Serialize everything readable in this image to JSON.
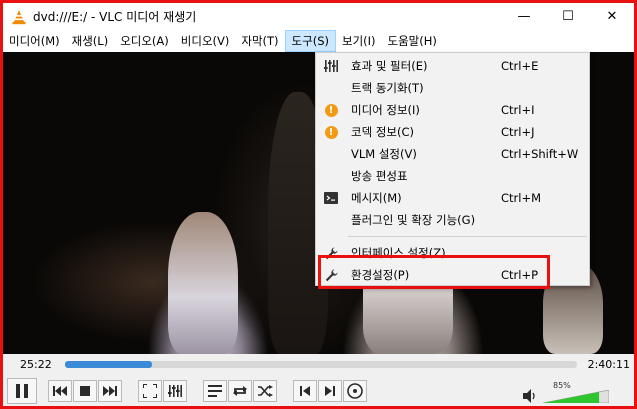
{
  "window": {
    "title": "dvd:///E:/ - VLC 미디어 재생기",
    "minimize_glyph": "—",
    "maximize_glyph": "☐",
    "close_glyph": "✕"
  },
  "menubar": {
    "items": [
      {
        "label": "미디어(M)"
      },
      {
        "label": "재생(L)"
      },
      {
        "label": "오디오(A)"
      },
      {
        "label": "비디오(V)"
      },
      {
        "label": "자막(T)"
      },
      {
        "label": "도구(S)"
      },
      {
        "label": "보기(I)"
      },
      {
        "label": "도움말(H)"
      }
    ],
    "active_index": 5
  },
  "tools_menu": {
    "items": [
      {
        "label": "효과 및 필터(E)",
        "shortcut": "Ctrl+E",
        "icon": "equalizer-icon"
      },
      {
        "label": "트랙 동기화(T)",
        "shortcut": "",
        "icon": ""
      },
      {
        "label": "미디어 정보(I)",
        "shortcut": "Ctrl+I",
        "icon": "info-icon"
      },
      {
        "label": "코덱 정보(C)",
        "shortcut": "Ctrl+J",
        "icon": "info-icon"
      },
      {
        "label": "VLM 설정(V)",
        "shortcut": "Ctrl+Shift+W",
        "icon": ""
      },
      {
        "label": "방송 편성표",
        "shortcut": "",
        "icon": ""
      },
      {
        "label": "메시지(M)",
        "shortcut": "Ctrl+M",
        "icon": "terminal-icon"
      },
      {
        "label": "플러그인 및 확장 기능(G)",
        "shortcut": "",
        "icon": ""
      },
      {
        "label": "인터페이스 설정(Z)",
        "shortcut": "",
        "icon": "wrench-icon"
      },
      {
        "label": "환경설정(P)",
        "shortcut": "Ctrl+P",
        "icon": "wrench-icon"
      }
    ],
    "highlight_color": "#e81010"
  },
  "playback": {
    "elapsed": "25:22",
    "total": "2:40:11",
    "progress_fraction": 0.17
  },
  "volume": {
    "label": "85%",
    "level_fraction": 0.85
  },
  "colors": {
    "accent": "#3b8ad8",
    "volume_green": "#2ec52e",
    "info_orange": "#f29a12"
  }
}
